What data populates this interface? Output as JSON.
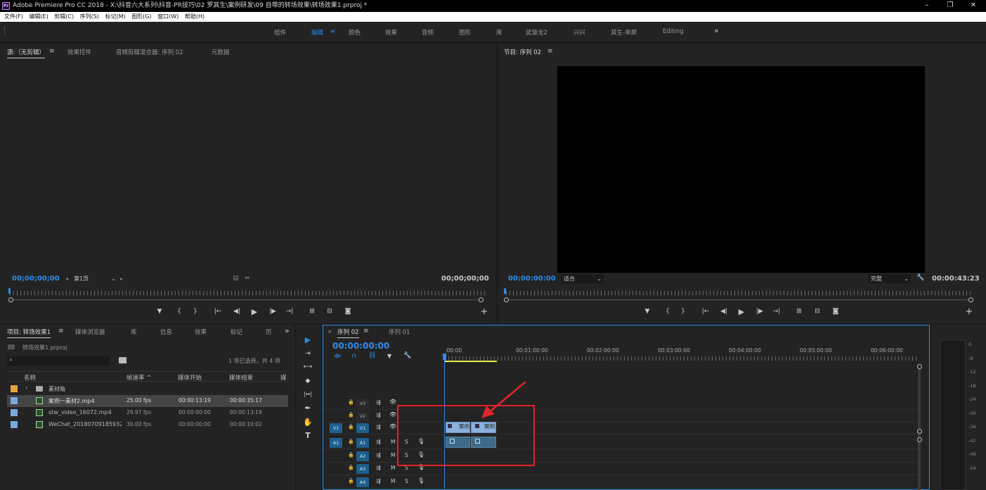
{
  "window": {
    "app_icon": "Pr",
    "title": "Adobe Premiere Pro CC 2018 - X:\\抖音六大系列\\抖音-PR技巧\\02 罗其生\\案例研发\\09 自带的转场效果\\转场效果1.prproj *",
    "minimize": "–",
    "restore": "❐",
    "close": "✕"
  },
  "menu": [
    "文件(F)",
    "编辑(E)",
    "剪辑(C)",
    "序列(S)",
    "标记(M)",
    "图形(G)",
    "窗口(W)",
    "帮助(H)"
  ],
  "workspaces": [
    "组件",
    "编辑",
    "颜色",
    "效果",
    "音频",
    "图形",
    "库",
    "武慧龙2",
    "兴兴",
    "其生-单屏",
    "Editing"
  ],
  "workspace_menu_icon": "≡",
  "workspace_more": "»",
  "source_panel": {
    "tabs": [
      "源:（无剪辑）",
      "效果控件",
      "音频剪辑混合器: 序列 02",
      "元数据"
    ],
    "menu_icon": "≡",
    "timecode_left": "00;00;00;00",
    "page_select": "第1页",
    "timecode_right": "00;00;00;00",
    "add": "+"
  },
  "program_panel": {
    "title": "节目: 序列 02",
    "menu_icon": "≡",
    "timecode_left": "00:00:00:00",
    "fit": "适合",
    "quality": "完整",
    "timecode_right": "00:00:43:23",
    "add": "+"
  },
  "controls": {
    "marker": "▼",
    "in": "{",
    "out": "}",
    "go_in": "|←",
    "step_back": "◀|",
    "play": "▶",
    "step_fwd": "|▶",
    "go_out": "→|",
    "insert": "⊞",
    "overwrite": "⊟",
    "export_frame": "◙",
    "chevron": "⌄",
    "settings": "🔧"
  },
  "project_panel": {
    "tabs": [
      "项目: 转场效果1",
      "媒体浏览器",
      "库",
      "信息",
      "效果",
      "标记",
      "历"
    ],
    "menu_icon": "≡",
    "more": "»",
    "project_file": "转场效果1.prproj",
    "search_icon": "⌕",
    "status": "1 项已选择，共 4 项",
    "columns": [
      "名称",
      "帧速率 ^",
      "媒体开始",
      "媒体结束",
      "媒"
    ],
    "rows": [
      {
        "name": "素材箱",
        "fps": "",
        "start": "",
        "end": "",
        "color": "#e8a33c",
        "type": "bin",
        "expand": "›"
      },
      {
        "name": "案例一素材2.mp4",
        "fps": "25.00 fps",
        "start": "00:00:13:19",
        "end": "00:00:35:17",
        "color": "#7aa7e0",
        "type": "clip",
        "selected": true
      },
      {
        "name": "stw_video_16072.mp4",
        "fps": "29.97 fps",
        "start": "00:00:00:00",
        "end": "00:00:13:19",
        "color": "#7aa7e0",
        "type": "clip"
      },
      {
        "name": "WeChat_20180709185932.mp",
        "fps": "30.00 fps",
        "start": "00:00:00:00",
        "end": "00:00:10:02",
        "color": "#7aa7e0",
        "type": "clip"
      }
    ]
  },
  "tools": [
    "▶",
    "⇥",
    "⟷",
    "◆",
    "|↔|",
    "✒",
    "✋",
    "T"
  ],
  "timeline": {
    "close": "×",
    "tabs": [
      "序列 02",
      "序列 01"
    ],
    "menu_icon": "≡",
    "timecode": "00:00:00:00",
    "ruler_labels": [
      ":00:00",
      "00:01:00:00",
      "00:02:00:00",
      "00:03:00:00",
      "00:04:00:00",
      "00:05:00:00",
      "00:06:00:00"
    ],
    "lock": "🔒",
    "eye": "👁",
    "mic": "🎙",
    "tracks": [
      {
        "label": "V3",
        "kind": "video",
        "patch": ""
      },
      {
        "label": "V2",
        "kind": "video",
        "patch": ""
      },
      {
        "label": "V1",
        "kind": "video",
        "patch": "V1"
      },
      {
        "label": "A1",
        "kind": "audio",
        "patch": "A1"
      },
      {
        "label": "A2",
        "kind": "audio",
        "patch": ""
      },
      {
        "label": "A3",
        "kind": "audio",
        "patch": ""
      },
      {
        "label": "A4",
        "kind": "audio",
        "patch": ""
      }
    ],
    "clip_labels": [
      "案例",
      "案例"
    ],
    "mute": "M",
    "solo": "S"
  },
  "meter_labels": [
    "0",
    "-6",
    "-12",
    "-18",
    "-24",
    "-30",
    "-36",
    "-42",
    "-48",
    "-54"
  ],
  "annotation_color": "#e0242a",
  "accent": "#2d8ceb"
}
